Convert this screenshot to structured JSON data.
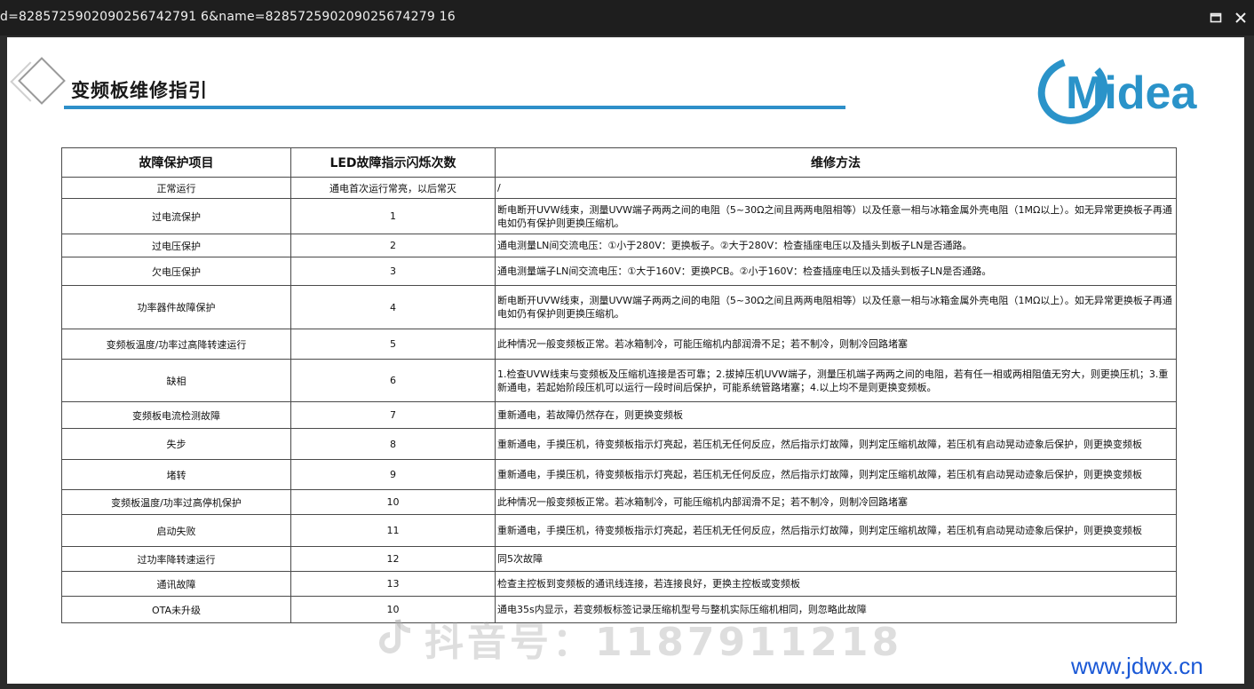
{
  "window": {
    "url": "d=8285725902090256742791 6&name=828572590209025674279 16"
  },
  "header": {
    "title": "变频板维修指引",
    "logo": "Midea"
  },
  "table": {
    "columns": [
      "故障保护项目",
      "LED故障指示闪烁次数",
      "维修方法"
    ],
    "rows": [
      {
        "item": "正常运行",
        "led": "通电首次运行常亮，以后常灭",
        "method": "/"
      },
      {
        "item": "过电流保护",
        "led": "1",
        "method": "断电断开UVW线束，测量UVW端子两两之间的电阻（5~30Ω之间且两两电阻相等）以及任意一相与冰箱金属外壳电阻（1MΩ以上）。如无异常更换板子再通电如仍有保护则更换压缩机。"
      },
      {
        "item": "过电压保护",
        "led": "2",
        "method": "通电测量LN间交流电压：①小于280V：更换板子。②大于280V：检查插座电压以及插头到板子LN是否通路。"
      },
      {
        "item": "欠电压保护",
        "led": "3",
        "method": "通电测量端子LN间交流电压：①大于160V：更换PCB。②小于160V：检查插座电压以及插头到板子LN是否通路。"
      },
      {
        "item": "功率器件故障保护",
        "led": "4",
        "method": "断电断开UVW线束，测量UVW端子两两之间的电阻（5~30Ω之间且两两电阻相等）以及任意一相与冰箱金属外壳电阻（1MΩ以上）。如无异常更换板子再通电如仍有保护则更换压缩机。"
      },
      {
        "item": "变频板温度/功率过高降转速运行",
        "led": "5",
        "method": "此种情况一般变频板正常。若冰箱制冷，可能压缩机内部润滑不足；若不制冷，则制冷回路堵塞"
      },
      {
        "item": "缺相",
        "led": "6",
        "method": "1.检查UVW线束与变频板及压缩机连接是否可靠；2.拔掉压机UVW端子，测量压机端子两两之间的电阻，若有任一相或两相阻值无穷大，则更换压机；3.重新通电，若起始阶段压机可以运行一段时间后保护，可能系统管路堵塞；4.以上均不是则更换变频板。"
      },
      {
        "item": "变频板电流检测故障",
        "led": "7",
        "method": "重新通电，若故障仍然存在，则更换变频板"
      },
      {
        "item": "失步",
        "led": "8",
        "method": "重新通电，手摸压机，待变频板指示灯亮起，若压机无任何反应，然后指示灯故障，则判定压缩机故障，若压机有启动晃动迹象后保护，则更换变频板"
      },
      {
        "item": "堵转",
        "led": "9",
        "method": "重新通电，手摸压机，待变频板指示灯亮起，若压机无任何反应，然后指示灯故障，则判定压缩机故障，若压机有启动晃动迹象后保护，则更换变频板"
      },
      {
        "item": "变频板温度/功率过高停机保护",
        "led": "10",
        "method": "此种情况一般变频板正常。若冰箱制冷，可能压缩机内部润滑不足；若不制冷，则制冷回路堵塞"
      },
      {
        "item": "启动失败",
        "led": "11",
        "method": "重新通电，手摸压机，待变频板指示灯亮起，若压机无任何反应，然后指示灯故障，则判定压缩机故障，若压机有启动晃动迹象后保护，则更换变频板"
      },
      {
        "item": "过功率降转速运行",
        "led": "12",
        "method": "同5次故障"
      },
      {
        "item": "通讯故障",
        "led": "13",
        "method": "检查主控板到变频板的通讯线连接，若连接良好，更换主控板或变频板"
      },
      {
        "item": "OTA未升级",
        "led": "10",
        "method": "通电35s内显示，若变频板标签记录压缩机型号与整机实际压缩机相同，则忽略此故障"
      }
    ],
    "row_heights": [
      24,
      40,
      26,
      32,
      49,
      34,
      48,
      30,
      35,
      34,
      28,
      36,
      28,
      28,
      30
    ]
  },
  "watermark": {
    "text": "抖音号：1187911218"
  },
  "site": {
    "text": "www.jdwx.cn"
  },
  "colors": {
    "accent": "#2e8fc9",
    "logo_blue": "#2a93c9",
    "site_blue": "#1a58d6"
  }
}
